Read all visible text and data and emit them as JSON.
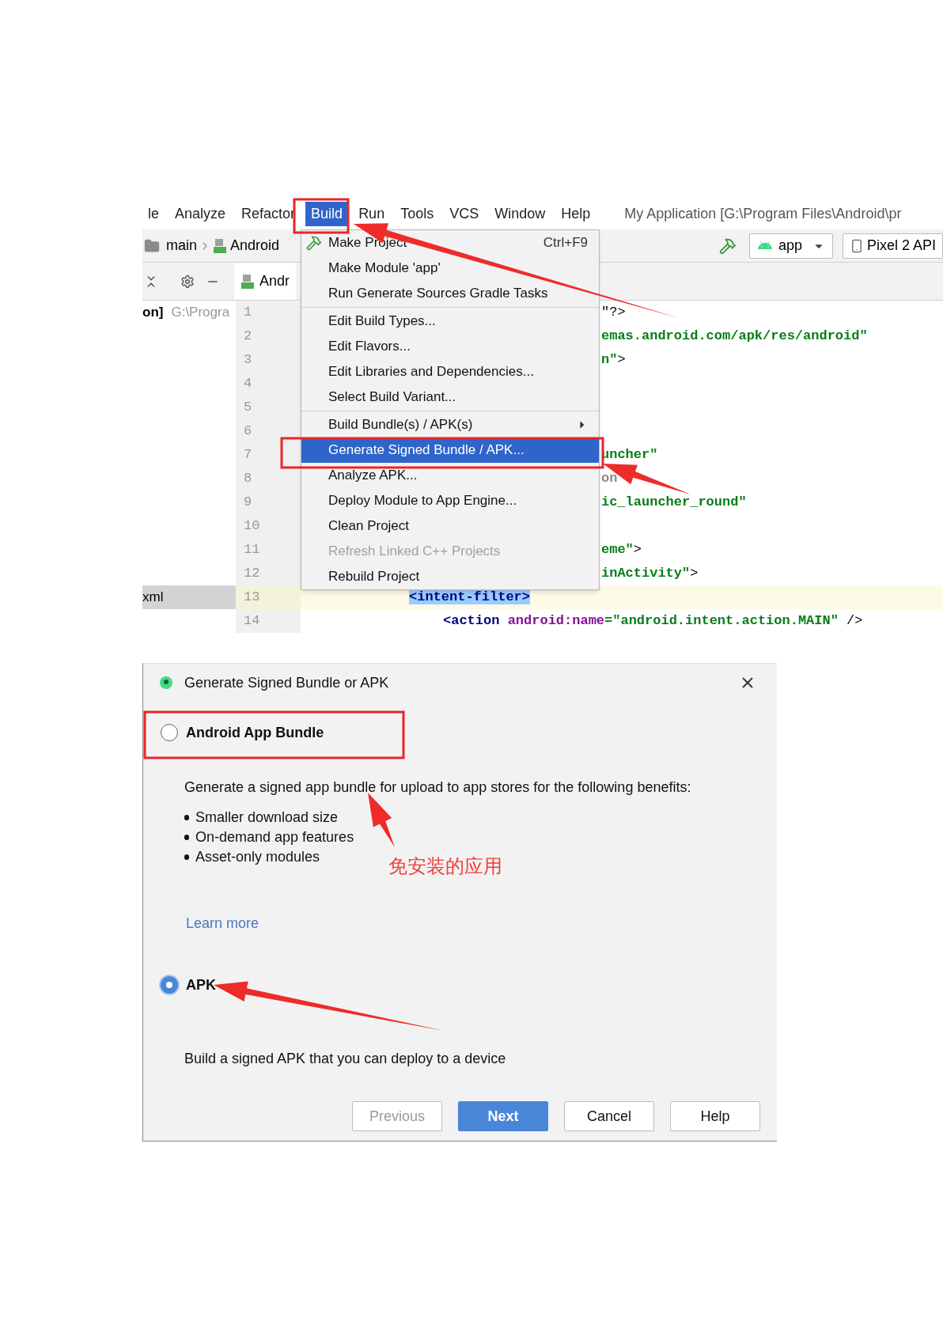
{
  "ide": {
    "menu_bar": [
      {
        "label": "le",
        "selected": false
      },
      {
        "label": "Analyze",
        "selected": false
      },
      {
        "label": "Refactor",
        "selected": false
      },
      {
        "label": "Build",
        "selected": true
      },
      {
        "label": "Run",
        "selected": false
      },
      {
        "label": "Tools",
        "selected": false
      },
      {
        "label": "VCS",
        "selected": false
      },
      {
        "label": "Window",
        "selected": false
      },
      {
        "label": "Help",
        "selected": false
      }
    ],
    "window_title": "My Application [G:\\Program Files\\Android\\pr",
    "breadcrumbs": [
      "main",
      "Android"
    ],
    "run_config": "app",
    "device": "Pixel 2 API",
    "editor_tab": "Andr",
    "project_panel": {
      "path_label": "on]",
      "path": "G:\\Progra",
      "file": {
        "name": "xml",
        "selected": true
      }
    },
    "lines": [
      {
        "number": "1",
        "current": false,
        "kind": "partial",
        "segments": [
          {
            "kind": "plain",
            "text": "\"?>"
          }
        ]
      },
      {
        "number": "2",
        "current": false,
        "kind": "partial",
        "segments": [
          {
            "kind": "value",
            "text": "emas.android.com/apk/res/android\""
          }
        ]
      },
      {
        "number": "3",
        "current": false,
        "kind": "partial",
        "segments": [
          {
            "kind": "value",
            "text": "n\""
          },
          {
            "kind": "plain",
            "text": ">"
          }
        ]
      },
      {
        "number": "4",
        "current": false,
        "kind": "partial"
      },
      {
        "number": "5",
        "current": false,
        "kind": "partial"
      },
      {
        "number": "6",
        "current": false,
        "kind": "partial"
      },
      {
        "number": "7",
        "current": false,
        "kind": "partial",
        "segments": [
          {
            "kind": "value",
            "text": "uncher\""
          }
        ]
      },
      {
        "number": "8",
        "current": false,
        "kind": "partial",
        "segments": [
          {
            "kind": "muted",
            "text": "on"
          }
        ]
      },
      {
        "number": "9",
        "current": false,
        "kind": "partial",
        "segments": [
          {
            "kind": "value",
            "text": "ic_launcher_round\""
          }
        ]
      },
      {
        "number": "10",
        "current": false,
        "kind": "partial"
      },
      {
        "number": "11",
        "current": false,
        "kind": "partial",
        "segments": [
          {
            "kind": "value",
            "text": "eme\""
          },
          {
            "kind": "plain",
            "text": ">"
          }
        ]
      },
      {
        "number": "12",
        "current": false,
        "kind": "partial",
        "segments": [
          {
            "kind": "value",
            "text": "inActivity\""
          },
          {
            "kind": "plain",
            "text": ">"
          }
        ]
      },
      {
        "number": "13",
        "current": true,
        "kind": "nested",
        "segments": [
          {
            "kind": "tag-highlight",
            "text": "<intent-filter>"
          }
        ]
      },
      {
        "number": "14",
        "current": false,
        "kind": "deep",
        "segments": [
          {
            "kind": "tag",
            "text": "<action "
          },
          {
            "kind": "attr",
            "text": "android:name"
          },
          {
            "kind": "value",
            "text": "=\"android.intent.action.MAIN\""
          },
          {
            "kind": "plain",
            "text": " />"
          }
        ]
      }
    ],
    "build_menu": [
      {
        "kind": "item",
        "label": "Make Project",
        "shortcut": "Ctrl+F9",
        "selected": false,
        "disabled": false
      },
      {
        "kind": "item",
        "label": "Make Module 'app'",
        "selected": false,
        "disabled": false
      },
      {
        "kind": "item",
        "label": "Run Generate Sources Gradle Tasks",
        "selected": false,
        "disabled": false
      },
      {
        "kind": "separator"
      },
      {
        "kind": "item",
        "label": "Edit Build Types...",
        "selected": false,
        "disabled": false
      },
      {
        "kind": "item",
        "label": "Edit Flavors...",
        "selected": false,
        "disabled": false
      },
      {
        "kind": "item",
        "label": "Edit Libraries and Dependencies...",
        "selected": false,
        "disabled": false
      },
      {
        "kind": "item",
        "label": "Select Build Variant...",
        "selected": false,
        "disabled": false
      },
      {
        "kind": "separator"
      },
      {
        "kind": "submenu",
        "label": "Build Bundle(s) / APK(s)",
        "selected": false,
        "disabled": false
      },
      {
        "kind": "item",
        "label": "Generate Signed Bundle / APK...",
        "selected": true,
        "disabled": false
      },
      {
        "kind": "item",
        "label": "Analyze APK...",
        "selected": false,
        "disabled": false
      },
      {
        "kind": "item",
        "label": "Deploy Module to App Engine...",
        "selected": false,
        "disabled": false
      },
      {
        "kind": "item",
        "label": "Clean Project",
        "selected": false,
        "disabled": false
      },
      {
        "kind": "item",
        "label": "Refresh Linked C++ Projects",
        "selected": false,
        "disabled": true
      },
      {
        "kind": "item",
        "label": "Rebuild Project",
        "selected": false,
        "disabled": false
      }
    ]
  },
  "dialog": {
    "title": "Generate Signed Bundle or APK",
    "options": [
      {
        "label": "Android App Bundle",
        "selected": false,
        "description": "Generate a signed app bundle for upload to app stores for the following benefits:",
        "benefits": [
          "Smaller download size",
          "On-demand app features",
          "Asset-only modules"
        ],
        "link": "Learn more"
      },
      {
        "label": "APK",
        "selected": true,
        "description": "Build a signed APK that you can deploy to a device"
      }
    ],
    "buttons": [
      {
        "label": "Previous",
        "kind": "secondary",
        "disabled": true
      },
      {
        "label": "Next",
        "kind": "primary",
        "disabled": false
      },
      {
        "label": "Cancel",
        "kind": "secondary",
        "disabled": false
      },
      {
        "label": "Help",
        "kind": "secondary",
        "disabled": false
      }
    ]
  },
  "annotations": [
    {
      "text": "免安装的应用"
    }
  ]
}
